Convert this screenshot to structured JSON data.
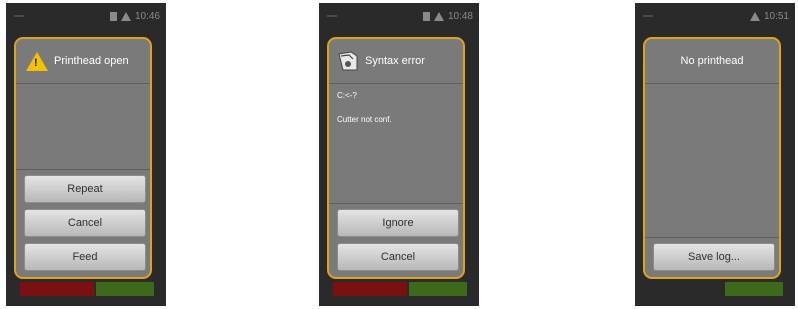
{
  "screens": [
    {
      "status_time": "10:46",
      "dialog": {
        "title": "Printhead open",
        "icon": "warning-icon",
        "buttons": [
          "Repeat",
          "Cancel",
          "Feed"
        ]
      }
    },
    {
      "status_time": "10:48",
      "dialog": {
        "title": "Syntax error",
        "icon": "syntax-error-icon",
        "messages": [
          "C:<-?",
          "Cutter not conf."
        ],
        "buttons": [
          "Ignore",
          "Cancel"
        ]
      }
    },
    {
      "status_time": "10:51",
      "dialog": {
        "title": "No printhead",
        "buttons": [
          "Save log..."
        ]
      }
    }
  ],
  "colors": {
    "dialog_border": "#e0a020",
    "dialog_bg": "#7a7a7a",
    "screen_bg": "#2a2a2a"
  }
}
